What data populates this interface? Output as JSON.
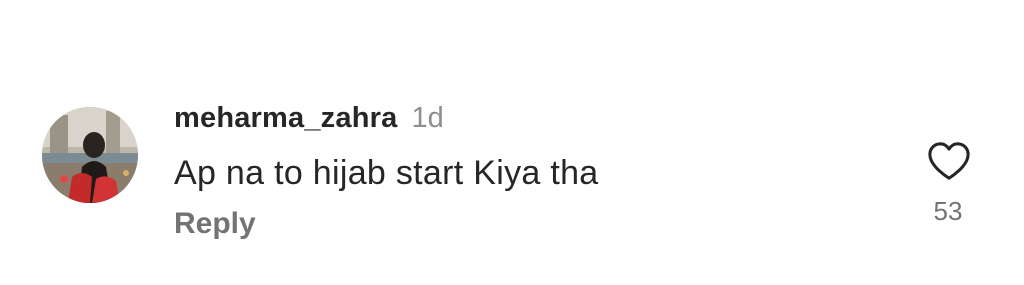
{
  "comment": {
    "username": "meharma_zahra",
    "timestamp": "1d",
    "text": "Ap na to hijab start Kiya tha",
    "reply_label": "Reply",
    "like_count": "53",
    "like_icon": "heart-outline-icon"
  },
  "colors": {
    "primary_text": "#262626",
    "secondary_text": "#737373",
    "timestamp_text": "#8e8e8e"
  }
}
